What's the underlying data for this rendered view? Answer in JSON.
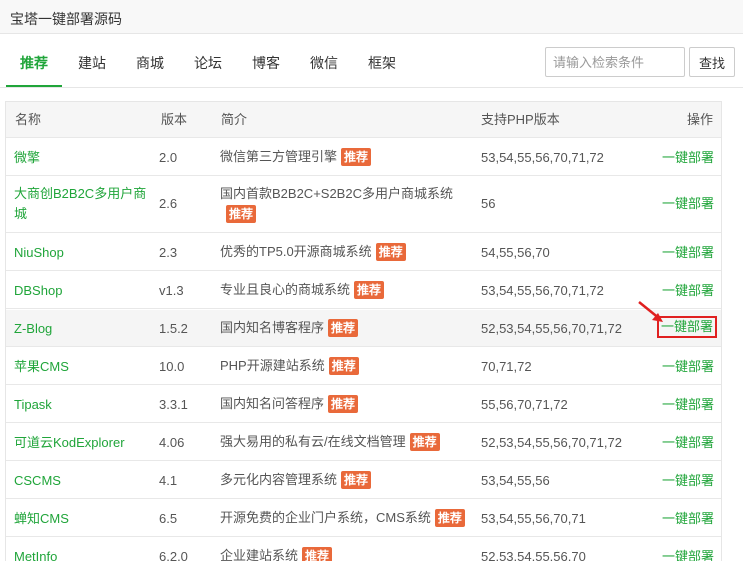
{
  "window": {
    "title": "宝塔一键部署源码"
  },
  "tabs": [
    "推荐",
    "建站",
    "商城",
    "论坛",
    "博客",
    "微信",
    "框架"
  ],
  "search": {
    "placeholder": "请输入检索条件",
    "button_label": "查找"
  },
  "table": {
    "headers": {
      "name": "名称",
      "version": "版本",
      "desc": "简介",
      "php": "支持PHP版本",
      "op": "操作"
    },
    "badge_label": "推荐",
    "action_label": "一键部署",
    "rows": [
      {
        "name": "微擎",
        "version": "2.0",
        "desc": "微信第三方管理引擎",
        "php": "53,54,55,56,70,71,72"
      },
      {
        "name": "大商创B2B2C多用户商",
        "name2": "城",
        "version": "2.6",
        "desc": "国内首款B2B2C+S2B2C多用户商城系统",
        "php": "56"
      },
      {
        "name": "NiuShop",
        "version": "2.3",
        "desc": "优秀的TP5.0开源商城系统",
        "php": "54,55,56,70"
      },
      {
        "name": "DBShop",
        "version": "v1.3",
        "desc": "专业且良心的商城系统",
        "php": "53,54,55,56,70,71,72"
      },
      {
        "name": "Z-Blog",
        "version": "1.5.2",
        "desc": "国内知名博客程序",
        "php": "52,53,54,55,56,70,71,72"
      },
      {
        "name": "苹果CMS",
        "version": "10.0",
        "desc": "PHP开源建站系统",
        "php": "70,71,72"
      },
      {
        "name": "Tipask",
        "version": "3.3.1",
        "desc": "国内知名问答程序",
        "php": "55,56,70,71,72"
      },
      {
        "name": "可道云KodExplorer",
        "version": "4.06",
        "desc": "强大易用的私有云/在线文档管理",
        "php": "52,53,54,55,56,70,71,72"
      },
      {
        "name": "CSCMS",
        "version": "4.1",
        "desc": "多元化内容管理系统",
        "php": "53,54,55,56"
      },
      {
        "name": "蝉知CMS",
        "version": "6.5",
        "desc": "开源免费的企业门户系统，CMS系统",
        "php": "53,54,55,56,70,71"
      },
      {
        "name": "MetInfo",
        "version": "6.2.0",
        "desc": "企业建站系统",
        "php": "52,53,54,55,56,70"
      }
    ]
  },
  "colors": {
    "accent": "#20a53a",
    "badge": "#e9693a",
    "highlight_box": "#e02020"
  }
}
